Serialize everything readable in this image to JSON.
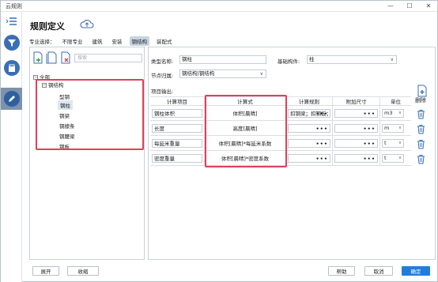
{
  "window": {
    "title": "云规则"
  },
  "header": {
    "title": "规则定义"
  },
  "filter": {
    "label": "专业选择：",
    "items": [
      {
        "label": "不限专业",
        "active": false
      },
      {
        "label": "建筑",
        "active": false
      },
      {
        "label": "安装",
        "active": false
      },
      {
        "label": "钢结构",
        "active": true
      },
      {
        "label": "装配式",
        "active": false
      }
    ]
  },
  "left": {
    "search_placeholder": "搜索",
    "tree": {
      "root": "全部",
      "group": "钢结构",
      "children": [
        "型钢",
        "钢柱",
        "钢梁",
        "钢檩条",
        "钢腰梁",
        "钢板"
      ],
      "selected": "钢柱"
    }
  },
  "form": {
    "type_name_label": "类型名称:",
    "type_name_value": "钢柱",
    "base_component_label": "基础构件:",
    "base_component_value": "柱",
    "node_label": "节点归属:",
    "node_value": "钢结构|钢结构",
    "output_label": "项目输出:"
  },
  "table": {
    "headers": [
      "计算项目",
      "计算式",
      "计算规则",
      "附加尺寸",
      "单位",
      "删除"
    ],
    "rows": [
      {
        "item": "钢柱体积",
        "formula": "体积[晨晴]",
        "rule": "扣钢梁；扣钢板；",
        "extra": "",
        "unit": "m3"
      },
      {
        "item": "长度",
        "formula": "高度[晨晴]",
        "rule": "",
        "extra": "",
        "unit": "m"
      },
      {
        "item": "每延米重量",
        "formula": "体积[晨晴]*每延米系数",
        "rule": "",
        "extra": "",
        "unit": "t"
      },
      {
        "item": "密度重量",
        "formula": "体积[晨晴]*密度系数",
        "rule": "",
        "extra": "",
        "unit": "t"
      }
    ],
    "dots": "•••"
  },
  "footer": {
    "expand": "展开",
    "collapse": "收缩",
    "help": "帮助",
    "cancel": "取消",
    "ok": "确定"
  },
  "colors": {
    "accent": "#1f7de0",
    "highlight": "#e0405a",
    "sidebar_active": "#7d93ab"
  }
}
